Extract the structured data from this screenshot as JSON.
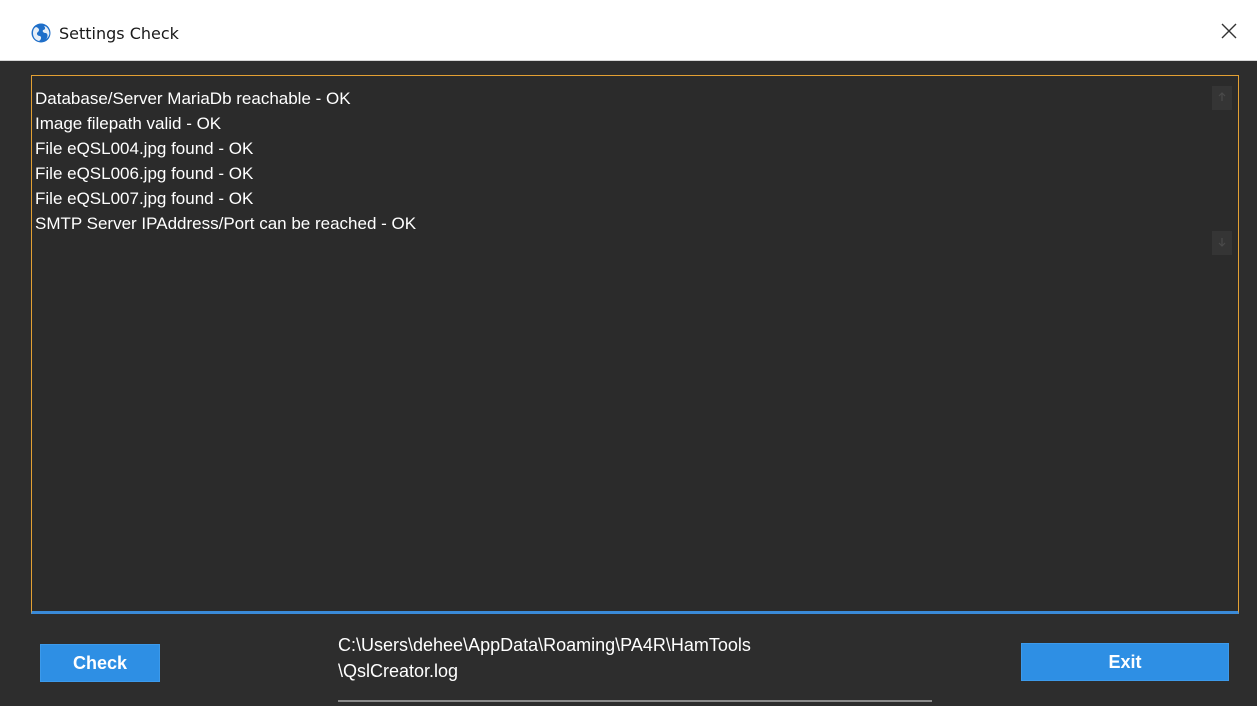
{
  "window": {
    "title": "Settings Check",
    "app_icon": "globe-icon",
    "close_icon": "close-icon"
  },
  "log": {
    "lines": [
      "Database/Server MariaDb reachable - OK",
      "Image filepath valid - OK",
      "File eQSL004.jpg found - OK",
      "File eQSL006.jpg found - OK",
      "File eQSL007.jpg found - OK",
      "SMTP Server IPAddress/Port can be reached - OK"
    ]
  },
  "footer": {
    "check_label": "Check",
    "exit_label": "Exit",
    "log_path_line1": "C:\\Users\\dehee\\AppData\\Roaming\\PA4R\\HamTools",
    "log_path_line2": "\\QslCreator.log"
  },
  "colors": {
    "background": "#2d2d2d",
    "panel_border": "#e3a033",
    "accent_blue": "#2e8fe4",
    "text": "#ffffff"
  }
}
